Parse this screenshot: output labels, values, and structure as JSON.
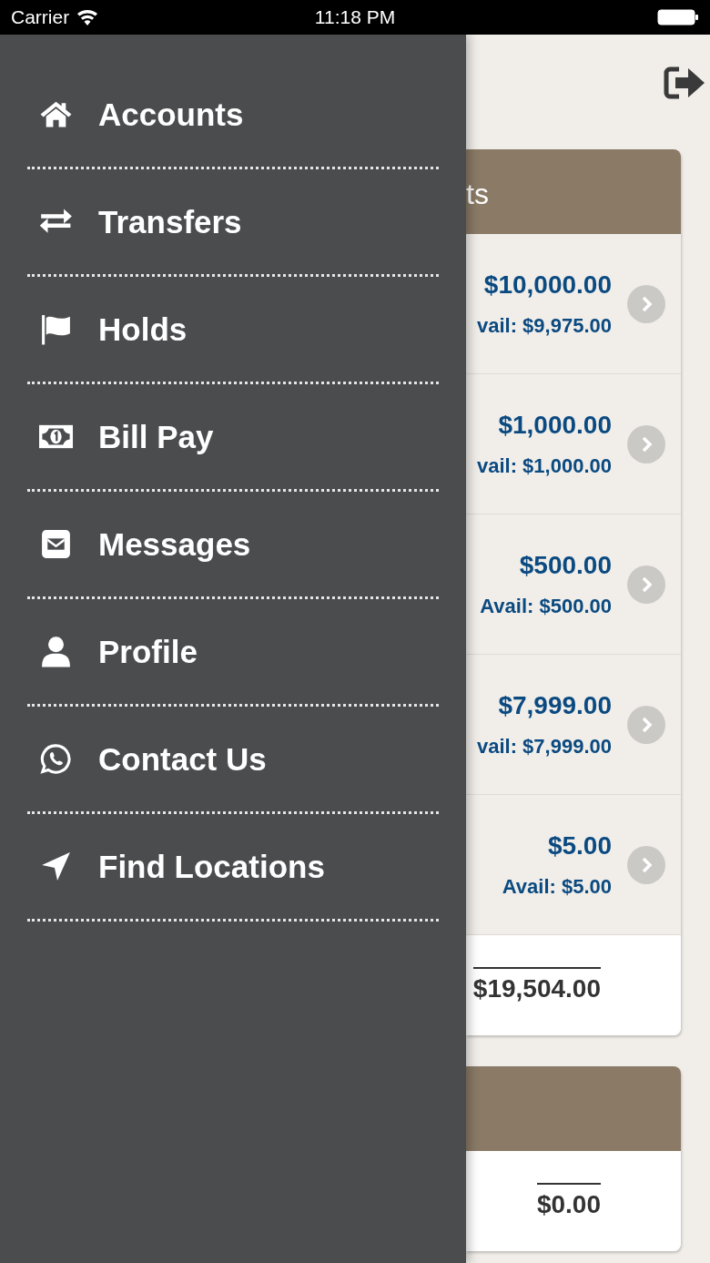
{
  "status_bar": {
    "carrier": "Carrier",
    "time": "11:18 PM"
  },
  "menu": {
    "items": [
      {
        "label": "Accounts",
        "kind": "home"
      },
      {
        "label": "Transfers",
        "kind": "transfer"
      },
      {
        "label": "Holds",
        "kind": "flag"
      },
      {
        "label": "Bill Pay",
        "kind": "bill"
      },
      {
        "label": "Messages",
        "kind": "envelope"
      },
      {
        "label": "Profile",
        "kind": "user"
      },
      {
        "label": "Contact Us",
        "kind": "phone"
      },
      {
        "label": "Find Locations",
        "kind": "location"
      }
    ]
  },
  "accounts_card": {
    "header": "ts",
    "rows": [
      {
        "balance": "$10,000.00",
        "available": "vail: $9,975.00"
      },
      {
        "balance": "$1,000.00",
        "available": "vail: $1,000.00"
      },
      {
        "balance": "$500.00",
        "available": "Avail: $500.00"
      },
      {
        "balance": "$7,999.00",
        "available": "vail: $7,999.00"
      },
      {
        "balance": "$5.00",
        "available": "Avail: $5.00"
      }
    ],
    "total": "$19,504.00"
  },
  "second_card": {
    "total": "$0.00"
  }
}
